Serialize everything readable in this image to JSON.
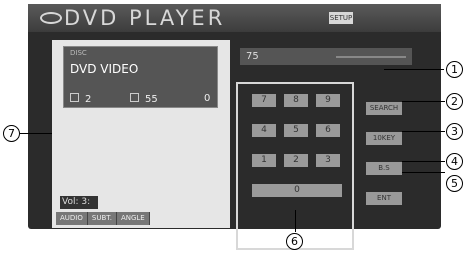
{
  "header": {
    "title": "DVD PLAYER",
    "setup_label": "SETUP"
  },
  "disc_panel": {
    "disc_label": "DISC",
    "disc_type": "DVD VIDEO",
    "title_num": "2",
    "chapter_num": "55",
    "extra": "0"
  },
  "vol": {
    "label": "Vol: 3:"
  },
  "source_buttons": [
    "AUDIO",
    "SUBT.",
    "ANGLE"
  ],
  "number_display": {
    "value": "75"
  },
  "keypad": {
    "keys": [
      "7",
      "8",
      "9",
      "4",
      "5",
      "6",
      "1",
      "2",
      "3",
      "0"
    ]
  },
  "function_buttons": [
    "SEARCH",
    "10KEY",
    "B.S",
    "ENT"
  ],
  "callouts": [
    "1",
    "2",
    "3",
    "4",
    "5",
    "6",
    "7"
  ],
  "colors": {
    "screen_bg": "#2b2b2b",
    "panel_bg": "#e6e6e6",
    "key_bg": "#9a9a9a"
  }
}
